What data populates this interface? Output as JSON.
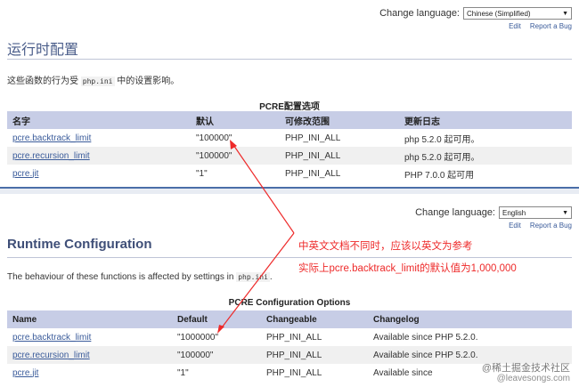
{
  "top": {
    "change_language_label": "Change language:",
    "language_selected": "Chinese (Simplified)",
    "edit_link": "Edit",
    "report_bug_link": "Report a Bug",
    "title": "运行时配置",
    "intro_before": "这些函数的行为受 ",
    "intro_code": "php.ini",
    "intro_after": " 中的设置影响。",
    "table_caption": "PCRE配置选项",
    "headers": [
      "名字",
      "默认",
      "可修改范围",
      "更新日志"
    ],
    "rows": [
      {
        "name": "pcre.backtrack_limit",
        "default": "\"100000\"",
        "changeable": "PHP_INI_ALL",
        "changelog": "php 5.2.0 起可用。"
      },
      {
        "name": "pcre.recursion_limit",
        "default": "\"100000\"",
        "changeable": "PHP_INI_ALL",
        "changelog": "php 5.2.0 起可用。"
      },
      {
        "name": "pcre.jit",
        "default": "\"1\"",
        "changeable": "PHP_INI_ALL",
        "changelog": "PHP 7.0.0 起可用"
      }
    ]
  },
  "bottom": {
    "change_language_label": "Change language:",
    "language_selected": "English",
    "edit_link": "Edit",
    "report_bug_link": "Report a Bug",
    "title": "Runtime Configuration",
    "intro_before": "The behaviour of these functions is affected by settings in ",
    "intro_code": "php.ini",
    "intro_after": ".",
    "table_caption": "PCRE Configuration Options",
    "headers": [
      "Name",
      "Default",
      "Changeable",
      "Changelog"
    ],
    "rows": [
      {
        "name": "pcre.backtrack_limit",
        "default": "\"1000000\"",
        "changeable": "PHP_INI_ALL",
        "changelog": "Available since PHP 5.2.0."
      },
      {
        "name": "pcre.recursion_limit",
        "default": "\"100000\"",
        "changeable": "PHP_INI_ALL",
        "changelog": "Available since PHP 5.2.0."
      },
      {
        "name": "pcre.jit",
        "default": "\"1\"",
        "changeable": "PHP_INI_ALL",
        "changelog": "Available since"
      }
    ]
  },
  "annotation": {
    "line1": "中英文文档不同时，应该以英文为参考",
    "line2": "实际上pcre.backtrack_limit的默认值为1,000,000",
    "color": "#ee2a2a"
  },
  "watermark": {
    "brand": "@稀土掘金技术社区",
    "site": "@leavesongs.com"
  }
}
